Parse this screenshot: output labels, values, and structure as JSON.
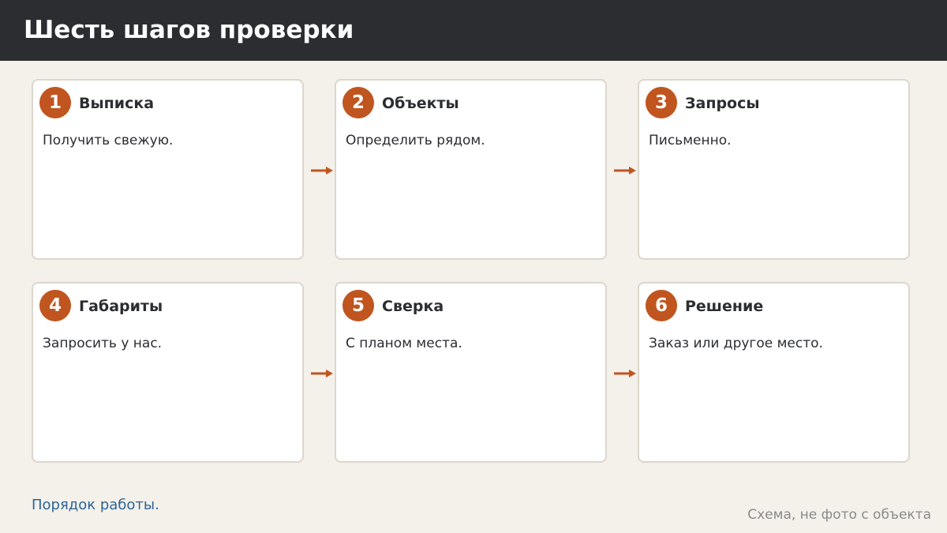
{
  "header": {
    "title": "Шесть шагов проверки"
  },
  "steps": [
    {
      "number": "1",
      "title": "Выписка",
      "text": "Получить свежую."
    },
    {
      "number": "2",
      "title": "Объекты",
      "text": "Определить рядом."
    },
    {
      "number": "3",
      "title": "Запросы",
      "text": "Письменно."
    },
    {
      "number": "4",
      "title": "Габариты",
      "text": "Запросить у нас."
    },
    {
      "number": "5",
      "title": "Сверка",
      "text": "С планом места."
    },
    {
      "number": "6",
      "title": "Решение",
      "text": "Заказ или другое место."
    }
  ],
  "footer": {
    "link_label": "Порядок работы.",
    "note": "Схема, не фото с объекта"
  },
  "colors": {
    "accent": "#c0551f",
    "header_bg": "#2b2d31",
    "page_bg": "#f4f1eb",
    "link": "#2a6496"
  }
}
